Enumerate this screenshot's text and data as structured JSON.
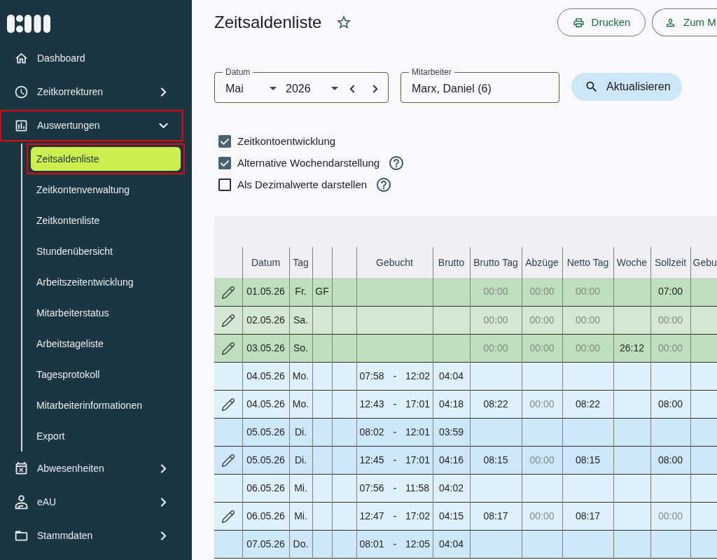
{
  "sidebar": {
    "items": [
      {
        "label": "Dashboard",
        "kind": "link",
        "highlighted": false
      },
      {
        "label": "Zeitkorrekturen",
        "kind": "group",
        "expanded": false,
        "highlighted": false
      },
      {
        "label": "Auswertungen",
        "kind": "group",
        "expanded": true,
        "highlighted": true,
        "children": [
          {
            "label": "Zeitsaldenliste",
            "selected": true,
            "highlighted": true
          },
          {
            "label": "Zeitkontenverwaltung",
            "selected": false,
            "highlighted": false
          },
          {
            "label": "Zeitkontenliste",
            "selected": false,
            "highlighted": false
          },
          {
            "label": "Stundenübersicht",
            "selected": false,
            "highlighted": false
          },
          {
            "label": "Arbeitszeitentwicklung",
            "selected": false,
            "highlighted": false
          },
          {
            "label": "Mitarbeiterstatus",
            "selected": false,
            "highlighted": false
          },
          {
            "label": "Arbeitstageliste",
            "selected": false,
            "highlighted": false
          },
          {
            "label": "Tagesprotokoll",
            "selected": false,
            "highlighted": false
          },
          {
            "label": "Mitarbeiterinformationen",
            "selected": false,
            "highlighted": false
          },
          {
            "label": "Export",
            "selected": false,
            "highlighted": false
          }
        ]
      },
      {
        "label": "Abwesenheiten",
        "kind": "group",
        "expanded": false,
        "highlighted": false
      },
      {
        "label": "eAU",
        "kind": "group",
        "expanded": false,
        "highlighted": false
      },
      {
        "label": "Stammdaten",
        "kind": "group",
        "expanded": false,
        "highlighted": false
      }
    ]
  },
  "page": {
    "title": "Zeitsaldenliste",
    "favorite": false,
    "buttons": [
      "Drucken",
      "Zum M"
    ]
  },
  "filters": {
    "date": {
      "label": "Datum",
      "month": "Mai",
      "year": "2026"
    },
    "employee": {
      "label": "Mitarbeiter",
      "value": "Marx, Daniel (6)"
    },
    "refresh_button": "Aktualisieren"
  },
  "options": [
    {
      "label": "Zeitkontoentwicklung",
      "checked": true,
      "help": false
    },
    {
      "label": "Alternative Wochendarstellung",
      "checked": true,
      "help": true
    },
    {
      "label": "Als Dezimalwerte darstellen",
      "checked": false,
      "help": true
    }
  ],
  "table": {
    "columns": [
      "",
      "Datum",
      "Tag",
      "",
      "",
      "Gebucht",
      "Brutto",
      "Brutto Tag",
      "Abzüge",
      "Netto Tag",
      "Woche",
      "Sollzeit",
      "Gebu"
    ],
    "rows": [
      {
        "editable": true,
        "color": "#bedebd",
        "cells": [
          "",
          "01.05.26",
          "Fr.",
          "GF",
          "",
          "",
          "",
          {
            "text": "00:00",
            "muted": true
          },
          {
            "text": "00:00",
            "muted": true
          },
          {
            "text": "00:00",
            "muted": true
          },
          "",
          "07:00",
          ""
        ]
      },
      {
        "editable": true,
        "color": "#d2e8d2",
        "cells": [
          "",
          "02.05.26",
          "Sa.",
          "",
          "",
          "",
          "",
          {
            "text": "00:00",
            "muted": true
          },
          {
            "text": "00:00",
            "muted": true
          },
          {
            "text": "00:00",
            "muted": true
          },
          "",
          {
            "text": "00:00",
            "muted": true
          },
          ""
        ]
      },
      {
        "editable": true,
        "color": "#bedebd",
        "cells": [
          "",
          "03.05.26",
          "So.",
          "",
          "",
          "",
          "",
          {
            "text": "00:00",
            "muted": true
          },
          {
            "text": "00:00",
            "muted": true
          },
          {
            "text": "00:00",
            "muted": true
          },
          "26:12",
          {
            "text": "00:00",
            "muted": true
          },
          ""
        ]
      },
      {
        "editable": false,
        "color": "#ddf0fb",
        "cells": [
          "",
          "04.05.26",
          "Mo.",
          "",
          "",
          "07:58 - 12:02",
          "04:04",
          "",
          "",
          "",
          "",
          "",
          ""
        ]
      },
      {
        "editable": true,
        "color": "#ddf0fb",
        "cells": [
          "",
          "04.05.26",
          "Mo.",
          "",
          "",
          "12:43 - 17:01",
          "04:18",
          "08:22",
          {
            "text": "00:00",
            "muted": true
          },
          "08:22",
          "",
          "08:00",
          ""
        ]
      },
      {
        "editable": false,
        "color": "#cde7f9",
        "cells": [
          "",
          "05.05.26",
          "Di.",
          "",
          "",
          "08:02 - 12:01",
          "03:59",
          "",
          "",
          "",
          "",
          "",
          ""
        ]
      },
      {
        "editable": true,
        "color": "#cde7f9",
        "cells": [
          "",
          "05.05.26",
          "Di.",
          "",
          "",
          "12:45 - 17:01",
          "04:16",
          "08:15",
          {
            "text": "00:00",
            "muted": true
          },
          "08:15",
          "",
          "08:00",
          ""
        ]
      },
      {
        "editable": false,
        "color": "#ddf0fb",
        "cells": [
          "",
          "06.05.26",
          "Mi.",
          "",
          "",
          "07:56 - 11:58",
          "04:02",
          "",
          "",
          "",
          "",
          "",
          ""
        ]
      },
      {
        "editable": true,
        "color": "#ddf0fb",
        "cells": [
          "",
          "06.05.26",
          "Mi.",
          "",
          "",
          "12:47 - 17:02",
          "04:15",
          "08:17",
          {
            "text": "00:00",
            "muted": true
          },
          "08:17",
          "",
          {
            "text": "00:00",
            "muted": true
          },
          ""
        ]
      },
      {
        "editable": false,
        "color": "#cde7f9",
        "cells": [
          "",
          "07.05.26",
          "Do.",
          "",
          "",
          "08:01 - 12:05",
          "04:04",
          "",
          "",
          "",
          "",
          "",
          ""
        ]
      }
    ]
  }
}
